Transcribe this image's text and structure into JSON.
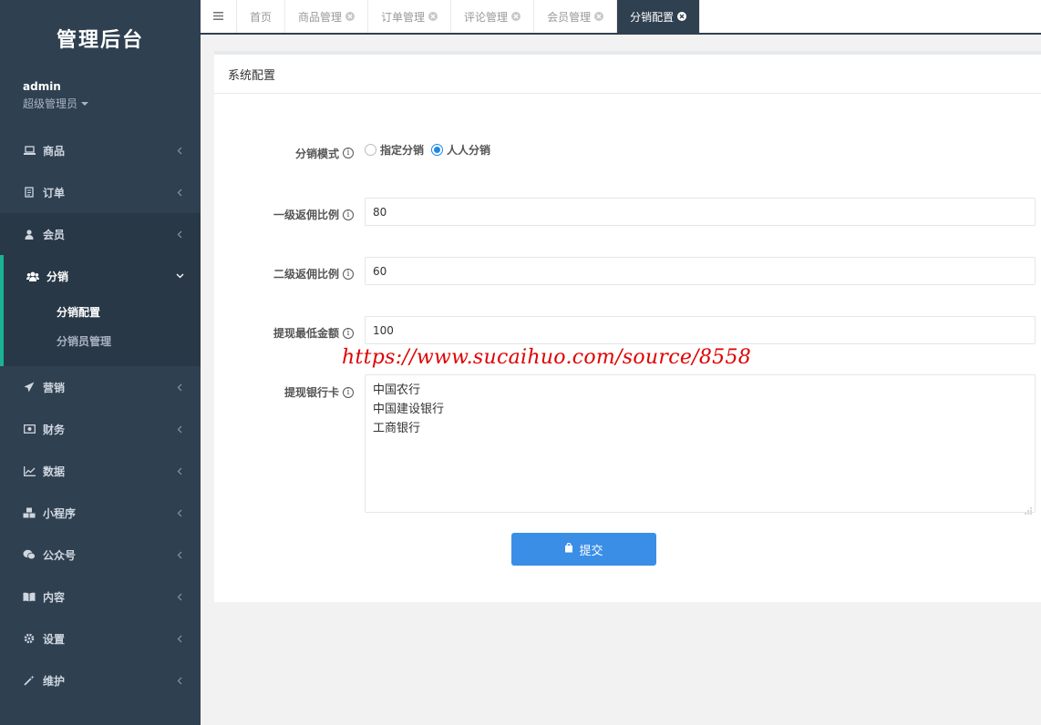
{
  "brand": "管理后台",
  "user": {
    "name": "admin",
    "role": "超级管理员"
  },
  "nav": [
    {
      "label": "商品",
      "icon": "laptop-icon"
    },
    {
      "label": "订单",
      "icon": "document-icon"
    },
    {
      "label": "会员",
      "icon": "user-icon"
    },
    {
      "label": "分销",
      "icon": "users-icon",
      "expanded": true,
      "children": [
        {
          "label": "分销配置",
          "active": true
        },
        {
          "label": "分销员管理"
        }
      ]
    },
    {
      "label": "营销",
      "icon": "paper-plane-icon"
    },
    {
      "label": "财务",
      "icon": "money-icon"
    },
    {
      "label": "数据",
      "icon": "line-chart-icon"
    },
    {
      "label": "小程序",
      "icon": "cubes-icon"
    },
    {
      "label": "公众号",
      "icon": "wechat-icon"
    },
    {
      "label": "内容",
      "icon": "book-icon"
    },
    {
      "label": "设置",
      "icon": "gear-icon"
    },
    {
      "label": "维护",
      "icon": "magic-wand-icon"
    }
  ],
  "tabs": [
    {
      "label": "首页",
      "closable": false
    },
    {
      "label": "商品管理",
      "closable": true
    },
    {
      "label": "订单管理",
      "closable": true
    },
    {
      "label": "评论管理",
      "closable": true
    },
    {
      "label": "会员管理",
      "closable": true
    },
    {
      "label": "分销配置",
      "closable": true,
      "active": true
    }
  ],
  "panel": {
    "title": "系统配置"
  },
  "form": {
    "mode_label": "分销模式",
    "mode_options": [
      {
        "label": "指定分销",
        "checked": false
      },
      {
        "label": "人人分销",
        "checked": true
      }
    ],
    "level1_label": "一级返佣比例",
    "level1_value": "80",
    "level2_label": "二级返佣比例",
    "level2_value": "60",
    "min_withdraw_label": "提现最低金额",
    "min_withdraw_value": "100",
    "bank_label": "提现银行卡",
    "bank_lines": [
      "中国农行",
      "中国建设银行",
      "工商银行"
    ],
    "submit_label": "提交"
  },
  "watermark": "https://www.sucaihuo.com/source/8558",
  "colors": {
    "sidebar": "#2f4050",
    "accent": "#3a8ee6",
    "watermark": "#e00000"
  }
}
